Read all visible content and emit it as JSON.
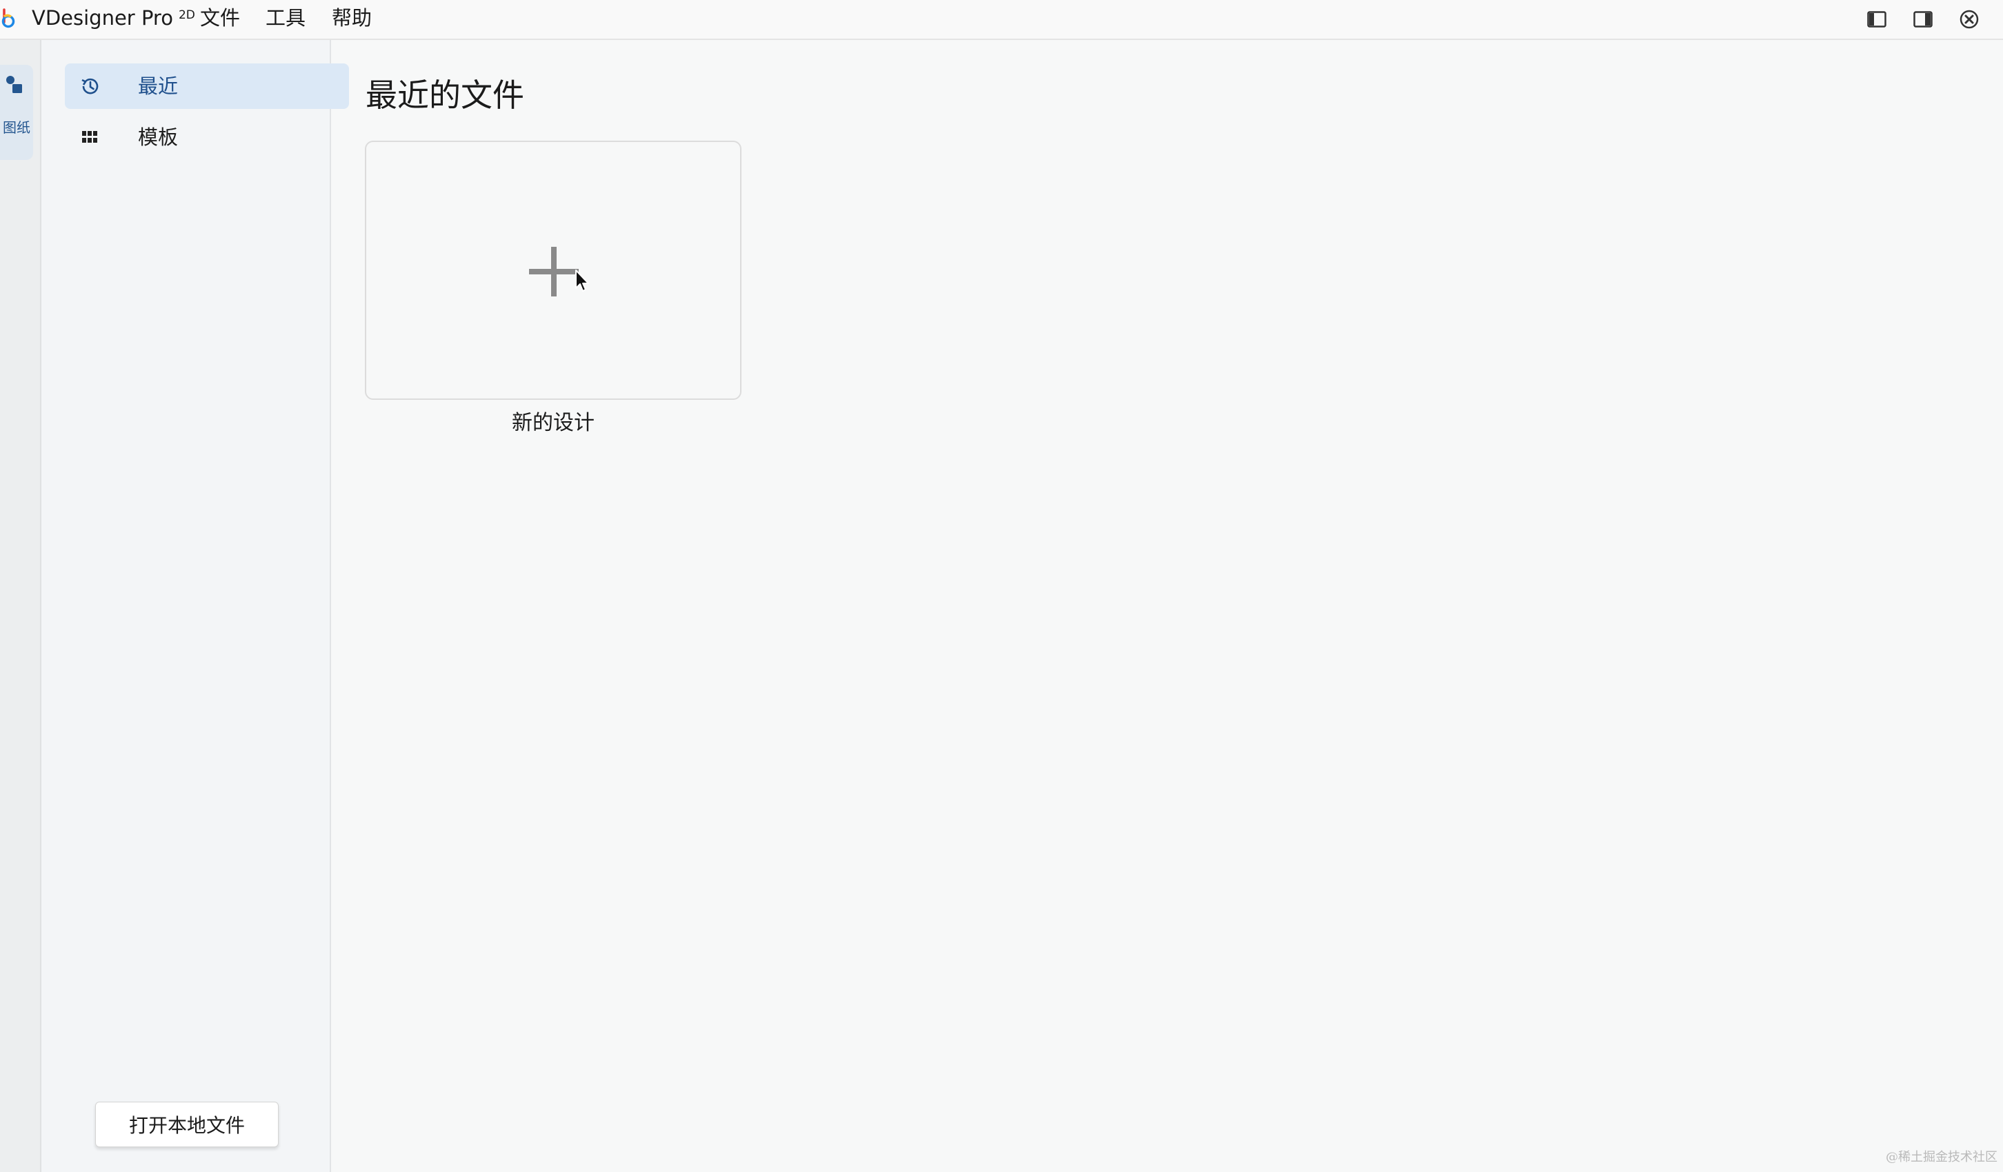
{
  "titlebar": {
    "app_name": "VDesigner Pro",
    "app_sup": "2D",
    "menu": [
      "文件",
      "工具",
      "帮助"
    ],
    "window_buttons": [
      "toggle-left-panel-icon",
      "toggle-right-panel-icon",
      "close-icon"
    ]
  },
  "activity_bar": {
    "items": [
      {
        "label": "图纸",
        "icon": "drawings-icon"
      }
    ]
  },
  "sidebar": {
    "items": [
      {
        "label": "最近",
        "icon": "history-icon",
        "active": true
      },
      {
        "label": "模板",
        "icon": "grid-icon",
        "active": false
      }
    ],
    "open_local_label": "打开本地文件"
  },
  "main": {
    "title": "最近的文件",
    "cards": [
      {
        "label": "新的设计",
        "icon": "plus-icon"
      }
    ]
  },
  "watermark": "@稀土掘金技术社区",
  "colors": {
    "accent": "#1e4f8c",
    "active_bg": "#dbe8f6",
    "background": "#f7f8f8",
    "logo": [
      "#e53935",
      "#fbc02d",
      "#1e88e5"
    ]
  }
}
